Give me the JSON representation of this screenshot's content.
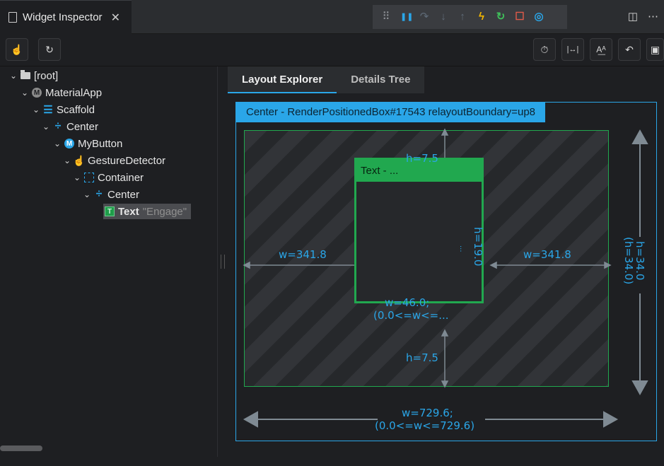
{
  "tab": {
    "title": "Widget Inspector",
    "close": "✕"
  },
  "debug_toolbar": {
    "icons": [
      "drag-handle-icon",
      "pause-icon",
      "step-over-icon",
      "step-into-icon",
      "step-out-icon",
      "hot-reload-icon",
      "hot-restart-icon",
      "stop-icon",
      "devtools-icon"
    ],
    "glyphs": [
      "⠿",
      "❚❚",
      "↷",
      "↓",
      "↑",
      "ϟ",
      "↻",
      "☐",
      "◎"
    ],
    "colors": {
      "pause": "#2aa6e8",
      "hot_reload": "#f5b800",
      "restart": "#3fbf5a",
      "stop": "#e05a4a",
      "devtools": "#2aa6e8",
      "disabled": "#5f6b78"
    }
  },
  "corner": {
    "split": "◫",
    "more": "⋯"
  },
  "toolbar": {
    "left": [
      {
        "icon": "select-widget-mode-icon",
        "glyph": "☝"
      },
      {
        "icon": "refresh-icon",
        "glyph": "↻"
      }
    ],
    "right": [
      {
        "icon": "slow-animations-icon",
        "glyph": "⏱"
      },
      {
        "icon": "show-guidelines-icon",
        "glyph": "|↔|"
      },
      {
        "icon": "show-baselines-icon",
        "glyph": "A͟ᴬ"
      },
      {
        "icon": "highlight-repaints-icon",
        "glyph": "↶"
      },
      {
        "icon": "highlight-oversized-images-icon",
        "glyph": "▣"
      }
    ]
  },
  "tree": [
    {
      "label": "[root]",
      "icon": "folder-icon",
      "depth": 0
    },
    {
      "label": "MaterialApp",
      "icon": "material-app-icon",
      "depth": 1
    },
    {
      "label": "Scaffold",
      "icon": "scaffold-icon",
      "depth": 2
    },
    {
      "label": "Center",
      "icon": "center-icon",
      "depth": 3
    },
    {
      "label": "MyButton",
      "icon": "my-button-icon",
      "depth": 4
    },
    {
      "label": "GestureDetector",
      "icon": "gesture-detector-icon",
      "depth": 5
    },
    {
      "label": "Container",
      "icon": "container-icon",
      "depth": 6
    },
    {
      "label": "Center",
      "icon": "center-icon",
      "depth": 7
    },
    {
      "label": "Text",
      "icon": "text-icon",
      "depth": 8,
      "value": "\"Engage\"",
      "selected": true
    }
  ],
  "panel": {
    "tabs": [
      "Layout Explorer",
      "Details Tree"
    ],
    "active_tab": "Layout Explorer",
    "outer_box": {
      "label": "Center - RenderPositionedBox#17543 relayoutBoundary=up8"
    },
    "inner_box": {
      "label": "Text - ..."
    },
    "dimensions": {
      "top_gap": "h=7.5",
      "bottom_gap": "h=7.5",
      "left_gap": "w=341.8",
      "right_gap": "w=341.8",
      "inner_height": "h=19.0",
      "inner_height_ellipsis": "...",
      "inner_width_line1": "w=46.0;",
      "inner_width_line2": "(0.0<=w<=...",
      "outer_height_line1": "h=34.0",
      "outer_height_line2": "(h=34.0)",
      "outer_width_line1": "w=729.6;",
      "outer_width_line2": "(0.0<=w<=729.6)"
    }
  }
}
